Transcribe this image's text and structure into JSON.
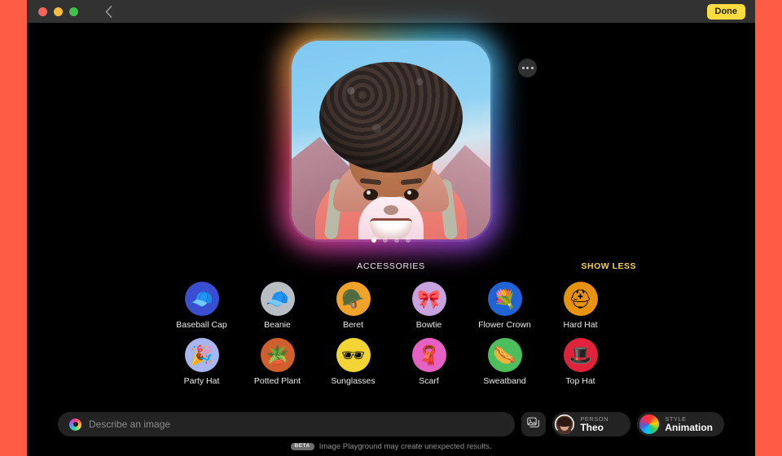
{
  "window": {
    "traffic_lights": [
      "close",
      "minimize",
      "zoom"
    ],
    "back_icon": "chevron-left-icon",
    "done_label": "Done",
    "done_color": "#fbdc3f"
  },
  "hero": {
    "more_icon": "ellipsis-icon",
    "image_alt": "Generated animation-style portrait of a smiling person with curly hair",
    "page_dots": 4,
    "active_dot": 1
  },
  "accessories": {
    "title": "ACCESSORIES",
    "show_less_label": "SHOW LESS",
    "show_less_color": "#f6d44a",
    "items": [
      {
        "label": "Baseball Cap",
        "icon": "baseball-cap-icon",
        "glyph": "🧢",
        "bg": "#3a4ed2"
      },
      {
        "label": "Beanie",
        "icon": "beanie-icon",
        "glyph": "🧢",
        "bg": "#b9bdc4"
      },
      {
        "label": "Beret",
        "icon": "beret-icon",
        "glyph": "🪖",
        "bg": "#f0a22a"
      },
      {
        "label": "Bowtie",
        "icon": "bowtie-icon",
        "glyph": "🎀",
        "bg": "#c7a3e0"
      },
      {
        "label": "Flower Crown",
        "icon": "flower-crown-icon",
        "glyph": "💐",
        "bg": "#1f63d6"
      },
      {
        "label": "Hard Hat",
        "icon": "hard-hat-icon",
        "glyph": "⛑",
        "bg": "#e8930f"
      },
      {
        "label": "Party Hat",
        "icon": "party-hat-icon",
        "glyph": "🎉",
        "bg": "#a7b6ef"
      },
      {
        "label": "Potted Plant",
        "icon": "potted-plant-icon",
        "glyph": "🪴",
        "bg": "#d05f2d"
      },
      {
        "label": "Sunglasses",
        "icon": "sunglasses-icon",
        "glyph": "🕶",
        "bg": "#f2d534"
      },
      {
        "label": "Scarf",
        "icon": "scarf-icon",
        "glyph": "🧣",
        "bg": "#e561c4"
      },
      {
        "label": "Sweatband",
        "icon": "sweatband-icon",
        "glyph": "🌭",
        "bg": "#4cbf5c"
      },
      {
        "label": "Top Hat",
        "icon": "top-hat-icon",
        "glyph": "🎩",
        "bg": "#e0233a"
      }
    ]
  },
  "prompt_bar": {
    "icon": "image-playground-icon",
    "placeholder": "Describe an image",
    "value": "",
    "photo_button_icon": "photo-picker-icon",
    "person_chip": {
      "caption": "PERSON",
      "value": "Theo",
      "thumb": "person-avatar"
    },
    "style_chip": {
      "caption": "STYLE",
      "value": "Animation",
      "thumb": "style-swatch"
    }
  },
  "footer": {
    "badge": "BETA",
    "text": "Image Playground may create unexpected results."
  }
}
